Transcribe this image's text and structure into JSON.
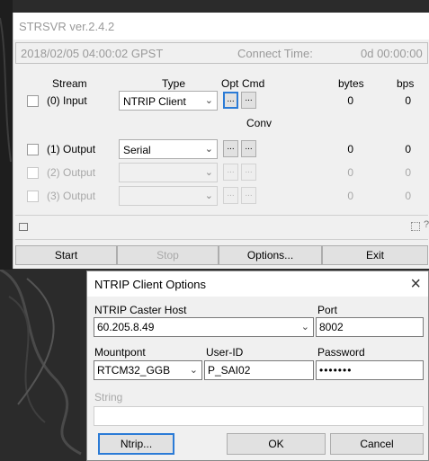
{
  "main": {
    "title": "STRSVR ver.2.4.2",
    "status": {
      "time": "2018/02/05 04:00:02 GPST",
      "connect_label": "Connect Time:",
      "connect_value": "0d 00:00:00"
    },
    "headers": {
      "stream": "Stream",
      "type": "Type",
      "opt": "Opt",
      "cmd": "Cmd",
      "bytes": "bytes",
      "bps": "bps",
      "conv": "Conv"
    },
    "rows": [
      {
        "label": "(0) Input",
        "type": "NTRIP Client",
        "opt": "...",
        "cmd": "...",
        "bytes": "0",
        "bps": "0"
      },
      {
        "label": "(1) Output",
        "type": "Serial",
        "opt": "...",
        "cmd": "...",
        "bytes": "0",
        "bps": "0"
      },
      {
        "label": "(2) Output",
        "type": "",
        "opt": "...",
        "cmd": "...",
        "bytes": "0",
        "bps": "0"
      },
      {
        "label": "(3) Output",
        "type": "",
        "opt": "...",
        "cmd": "...",
        "bytes": "0",
        "bps": "0"
      }
    ],
    "help_mark": "?",
    "buttons": {
      "start": "Start",
      "stop": "Stop",
      "options": "Options...",
      "exit": "Exit"
    }
  },
  "dialog": {
    "title": "NTRIP Client Options",
    "close": "×",
    "host_label": "NTRIP Caster Host",
    "host_value": "60.205.8.49",
    "port_label": "Port",
    "port_value": "8002",
    "mount_label": "Mountpont",
    "mount_value": "RTCM32_GGB",
    "user_label": "User-ID",
    "user_value": "P_SAI02",
    "pass_label": "Password",
    "pass_value": "•••••••",
    "string_label": "String",
    "string_value": "",
    "buttons": {
      "ntrip": "Ntrip...",
      "ok": "OK",
      "cancel": "Cancel"
    }
  },
  "icons": {
    "dropdown": "chevron-down-icon",
    "close": "close-icon"
  }
}
